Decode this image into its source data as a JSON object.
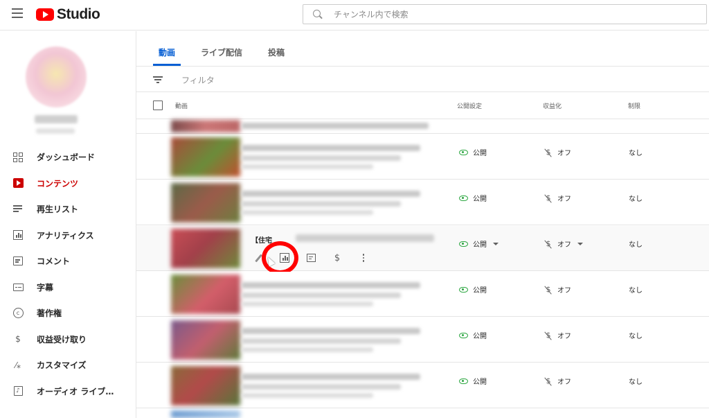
{
  "header": {
    "logo_text": "Studio",
    "search_placeholder": "チャンネル内で検索"
  },
  "sidebar": {
    "items": [
      {
        "label": "ダッシュボード",
        "icon": "dashboard-icon"
      },
      {
        "label": "コンテンツ",
        "icon": "content-icon",
        "active": true
      },
      {
        "label": "再生リスト",
        "icon": "playlist-icon"
      },
      {
        "label": "アナリティクス",
        "icon": "analytics-icon"
      },
      {
        "label": "コメント",
        "icon": "comment-icon"
      },
      {
        "label": "字幕",
        "icon": "subtitles-icon"
      },
      {
        "label": "著作権",
        "icon": "copyright-icon"
      },
      {
        "label": "収益受け取り",
        "icon": "dollar-icon"
      },
      {
        "label": "カスタマイズ",
        "icon": "magic-wand-icon"
      },
      {
        "label": "オーディオ ライブ…",
        "icon": "audio-library-icon"
      }
    ]
  },
  "tabs": [
    {
      "label": "動画",
      "active": true
    },
    {
      "label": "ライブ配信"
    },
    {
      "label": "投稿"
    }
  ],
  "filter": {
    "label": "フィルタ"
  },
  "table": {
    "headers": {
      "video": "動画",
      "visibility": "公開設定",
      "monetization": "収益化",
      "restrictions": "制限"
    },
    "rows": [
      {
        "visibility": "公開",
        "monetization": "オフ",
        "restrictions": "なし"
      },
      {
        "visibility": "公開",
        "monetization": "オフ",
        "restrictions": "なし"
      },
      {
        "visibility": "公開",
        "monetization": "オフ",
        "restrictions": "なし",
        "hover_title": "【住宅"
      },
      {
        "visibility": "公開",
        "monetization": "オフ",
        "restrictions": "なし"
      },
      {
        "visibility": "公開",
        "monetization": "オフ",
        "restrictions": "なし"
      },
      {
        "visibility": "公開",
        "monetization": "オフ",
        "restrictions": "なし"
      }
    ]
  },
  "row_actions": [
    "edit-icon",
    "analytics-icon",
    "comments-icon",
    "monetization-icon",
    "more-icon"
  ],
  "colors": {
    "brand_red": "#ff0000",
    "active_red": "#cc0000",
    "tab_blue": "#065fd4",
    "public_green": "#2ba640"
  }
}
